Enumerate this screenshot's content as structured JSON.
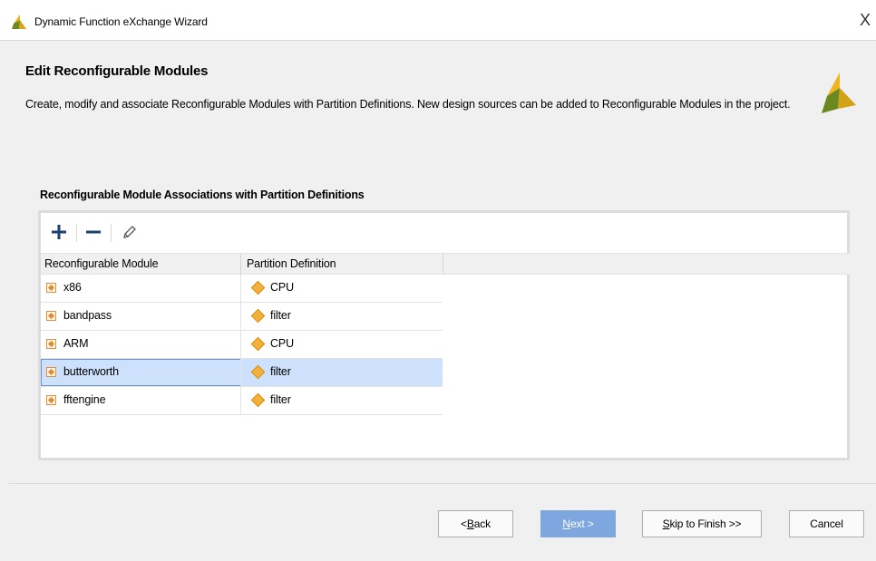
{
  "window": {
    "title": "Dynamic Function eXchange Wizard",
    "close_glyph": "X"
  },
  "header": {
    "heading": "Edit Reconfigurable Modules",
    "description": "Create, modify and associate Reconfigurable Modules with Partition Definitions. New design sources can be added to Reconfigurable Modules in the project."
  },
  "section": {
    "label": "Reconfigurable Module Associations with Partition Definitions"
  },
  "toolbar": {
    "icons": [
      "add-icon",
      "remove-icon",
      "edit-icon"
    ]
  },
  "table": {
    "columns": [
      "Reconfigurable Module",
      "Partition Definition"
    ],
    "rows": [
      {
        "module": "x86",
        "partition": "CPU",
        "selected": false
      },
      {
        "module": "bandpass",
        "partition": "filter",
        "selected": false
      },
      {
        "module": "ARM",
        "partition": "CPU",
        "selected": false
      },
      {
        "module": "butterworth",
        "partition": "filter",
        "selected": true
      },
      {
        "module": "fftengine",
        "partition": "filter",
        "selected": false
      }
    ]
  },
  "buttons": {
    "back": {
      "prefix": "< ",
      "mnemonic": "B",
      "rest": "ack"
    },
    "next": {
      "mnemonic": "N",
      "rest": "ext >"
    },
    "skip": {
      "mnemonic": "S",
      "rest": "kip to Finish >>"
    },
    "cancel": "Cancel"
  },
  "colors": {
    "accent_blue": "#7ea6df",
    "selection": "#cde1fc",
    "logo_yellow": "#f2b41c",
    "logo_green": "#6a8a1f"
  }
}
